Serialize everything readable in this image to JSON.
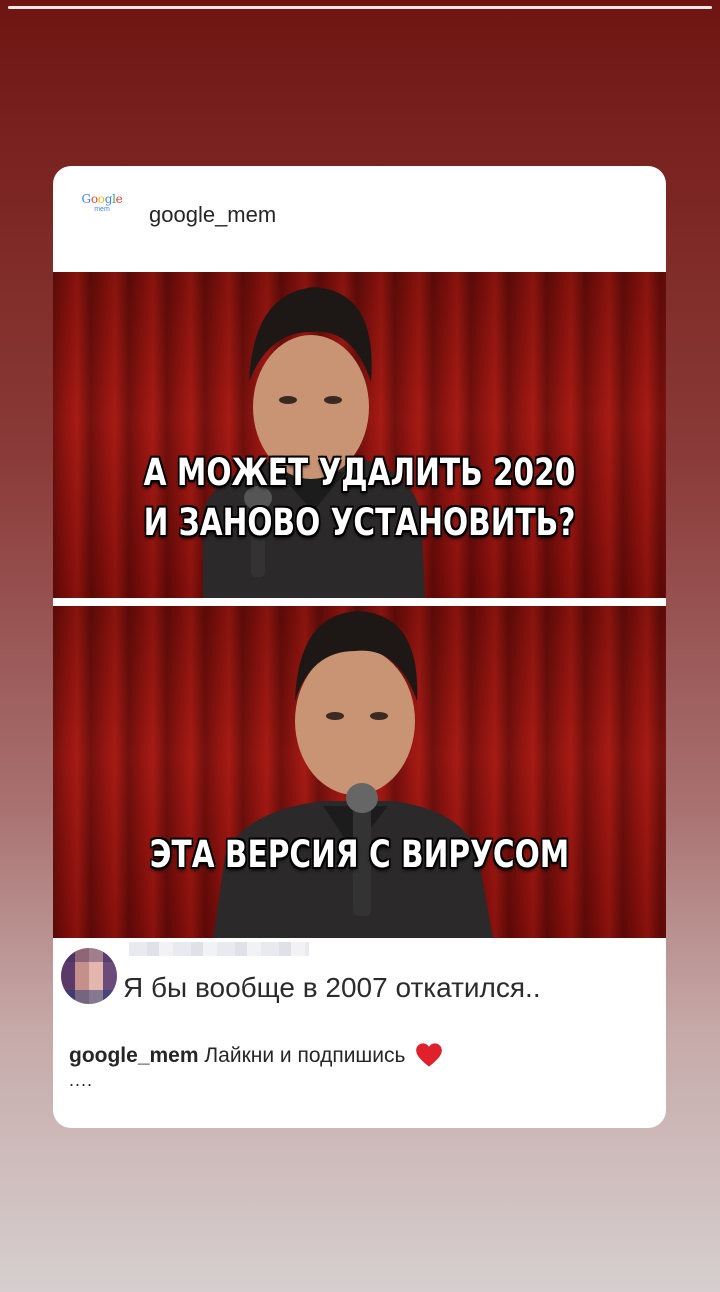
{
  "story": {
    "progress": 1.0
  },
  "post": {
    "logo_text": "Google",
    "logo_sub": "mem",
    "username": "google_mem",
    "meme": {
      "top_line1": "А МОЖЕТ УДАЛИТЬ 2020",
      "top_line2": "И ЗАНОВО УСТАНОВИТЬ?",
      "bottom_text": "ЭТА ВЕРСИЯ С ВИРУСОМ"
    },
    "comment": {
      "text": "Я бы вообще в 2007 откатился.."
    },
    "caption": {
      "user": "google_mem",
      "text": "Лайкни и подпишись",
      "more": "...."
    }
  },
  "colors": {
    "heart": "#e0202a"
  }
}
